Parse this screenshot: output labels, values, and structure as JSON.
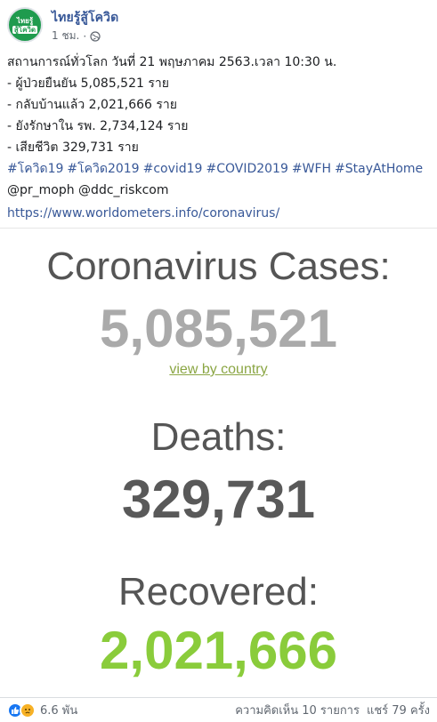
{
  "post": {
    "page_name": "ไทยรู้สู้โควิด",
    "avatar_line1": "ไทยรู้",
    "avatar_line2": "สู้โควิด",
    "time": "1 ชม.",
    "separator": "·",
    "privacy_icon": "globe-icon",
    "lines": [
      "สถานการณ์ทั่วโลก วันที่ 21 พฤษภาคม 2563.เวลา 10:30 น.",
      "- ผู้ป่วยยืนยัน 5,085,521 ราย",
      "- กลับบ้านแล้ว 2,021,666 ราย",
      "- ยังรักษาใน รพ. 2,734,124 ราย",
      "- เสียชีวิต 329,731 ราย"
    ],
    "hashtags": [
      "#โควิด19",
      "#โควิด2019",
      "#covid19",
      "#COVID2019",
      "#WFH",
      "#StayAtHome"
    ],
    "mentions": "@pr_moph @ddc_riskcom",
    "link": "https://www.worldometers.info/coronavirus/"
  },
  "preview": {
    "cases_label": "Coronavirus Cases:",
    "cases_value": "5,085,521",
    "view_by_country": "view by country",
    "deaths_label": "Deaths:",
    "deaths_value": "329,731",
    "recovered_label": "Recovered:",
    "recovered_value": "2,021,666"
  },
  "footer": {
    "reaction_icons": [
      "like-icon",
      "sad-icon"
    ],
    "reaction_count": "6.6 พัน",
    "comments": "ความคิดเห็น 10 รายการ",
    "shares": "แชร์ 79 ครั้ง"
  },
  "colors": {
    "link_blue": "#385898",
    "cases_gray": "#aaaaaa",
    "deaths_gray": "#595959",
    "recovered_green": "#8acc3b",
    "view_link_green": "#8ba644",
    "avatar_green": "#1f9b4e"
  }
}
